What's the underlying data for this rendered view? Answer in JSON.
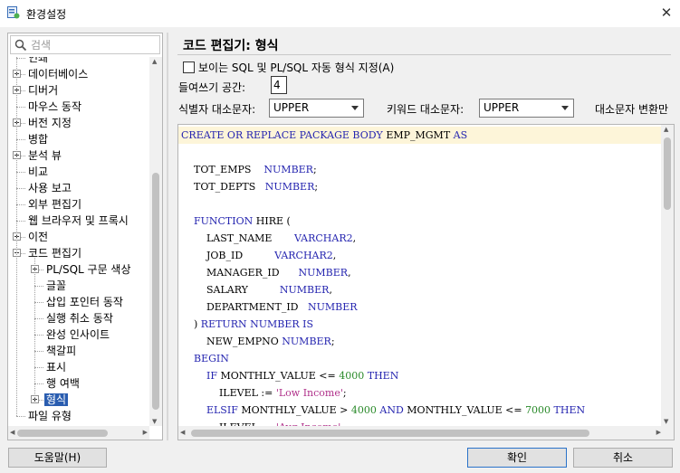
{
  "window": {
    "title": "환경설정",
    "close_glyph": "✕",
    "app_icon": "preferences-icon"
  },
  "search": {
    "placeholder": "검색",
    "icon": "search-icon"
  },
  "tree": {
    "items": [
      {
        "label": "인쇄",
        "level": 0,
        "expander": "none",
        "partial": true
      },
      {
        "label": "데이터베이스",
        "level": 0,
        "expander": "plus"
      },
      {
        "label": "디버거",
        "level": 0,
        "expander": "plus"
      },
      {
        "label": "마우스 동작",
        "level": 0,
        "expander": "none"
      },
      {
        "label": "버전 지정",
        "level": 0,
        "expander": "plus"
      },
      {
        "label": "병합",
        "level": 0,
        "expander": "none"
      },
      {
        "label": "분석 뷰",
        "level": 0,
        "expander": "plus"
      },
      {
        "label": "비교",
        "level": 0,
        "expander": "none"
      },
      {
        "label": "사용 보고",
        "level": 0,
        "expander": "none"
      },
      {
        "label": "외부 편집기",
        "level": 0,
        "expander": "none"
      },
      {
        "label": "웹 브라우저 및 프록시",
        "level": 0,
        "expander": "none"
      },
      {
        "label": "이전",
        "level": 0,
        "expander": "plus"
      },
      {
        "label": "코드 편집기",
        "level": 0,
        "expander": "minus"
      },
      {
        "label": "PL/SQL 구문 색상",
        "level": 1,
        "expander": "plus"
      },
      {
        "label": "글꼴",
        "level": 1,
        "expander": "none"
      },
      {
        "label": "삽입 포인터 동작",
        "level": 1,
        "expander": "none"
      },
      {
        "label": "실행 취소 동작",
        "level": 1,
        "expander": "none"
      },
      {
        "label": "완성 인사이트",
        "level": 1,
        "expander": "none"
      },
      {
        "label": "책갈피",
        "level": 1,
        "expander": "none"
      },
      {
        "label": "표시",
        "level": 1,
        "expander": "none"
      },
      {
        "label": "행 여백",
        "level": 1,
        "expander": "none"
      },
      {
        "label": "형식",
        "level": 1,
        "expander": "plus",
        "selected": true
      },
      {
        "label": "파일 유형",
        "level": 0,
        "expander": "none"
      }
    ]
  },
  "panel": {
    "title": "코드 편집기: 형식",
    "auto_format_label": "보이는 SQL 및 PL/SQL 자동 형식 지정(A)",
    "auto_format_checked": false,
    "indent_label": "들여쓰기 공간:",
    "indent_value": "4",
    "identifier_case_label": "식별자 대소문자:",
    "identifier_case_value": "UPPER",
    "keyword_case_label": "키워드 대소문자:",
    "keyword_case_value": "UPPER",
    "case_convert_label": "대소문자 변환만"
  },
  "code": {
    "lines": [
      [
        {
          "t": "CREATE OR REPLACE PACKAGE BODY ",
          "c": "kw"
        },
        {
          "t": "EMP_MGMT ",
          "c": ""
        },
        {
          "t": "AS",
          "c": "kw"
        }
      ],
      [],
      [
        {
          "t": "    TOT_EMPS    ",
          "c": ""
        },
        {
          "t": "NUMBER",
          "c": "kw"
        },
        {
          "t": ";",
          "c": ""
        }
      ],
      [
        {
          "t": "    TOT_DEPTS   ",
          "c": ""
        },
        {
          "t": "NUMBER",
          "c": "kw"
        },
        {
          "t": ";",
          "c": ""
        }
      ],
      [],
      [
        {
          "t": "    FUNCTION ",
          "c": "kw"
        },
        {
          "t": "HIRE (",
          "c": ""
        }
      ],
      [
        {
          "t": "        LAST_NAME       ",
          "c": ""
        },
        {
          "t": "VARCHAR2",
          "c": "kw"
        },
        {
          "t": ",",
          "c": ""
        }
      ],
      [
        {
          "t": "        JOB_ID          ",
          "c": ""
        },
        {
          "t": "VARCHAR2",
          "c": "kw"
        },
        {
          "t": ",",
          "c": ""
        }
      ],
      [
        {
          "t": "        MANAGER_ID      ",
          "c": ""
        },
        {
          "t": "NUMBER",
          "c": "kw"
        },
        {
          "t": ",",
          "c": ""
        }
      ],
      [
        {
          "t": "        SALARY          ",
          "c": ""
        },
        {
          "t": "NUMBER",
          "c": "kw"
        },
        {
          "t": ",",
          "c": ""
        }
      ],
      [
        {
          "t": "        DEPARTMENT_ID   ",
          "c": ""
        },
        {
          "t": "NUMBER",
          "c": "kw"
        }
      ],
      [
        {
          "t": "    ) ",
          "c": ""
        },
        {
          "t": "RETURN NUMBER IS",
          "c": "kw"
        }
      ],
      [
        {
          "t": "        NEW_EMPNO ",
          "c": ""
        },
        {
          "t": "NUMBER",
          "c": "kw"
        },
        {
          "t": ";",
          "c": ""
        }
      ],
      [
        {
          "t": "    BEGIN",
          "c": "kw"
        }
      ],
      [
        {
          "t": "        IF ",
          "c": "kw"
        },
        {
          "t": "MONTHLY_VALUE <= ",
          "c": ""
        },
        {
          "t": "4000",
          "c": "num"
        },
        {
          "t": " THEN",
          "c": "kw"
        }
      ],
      [
        {
          "t": "            ILEVEL := ",
          "c": ""
        },
        {
          "t": "'Low Income'",
          "c": "str"
        },
        {
          "t": ";",
          "c": ""
        }
      ],
      [
        {
          "t": "        ELSIF ",
          "c": "kw"
        },
        {
          "t": "MONTHLY_VALUE > ",
          "c": ""
        },
        {
          "t": "4000",
          "c": "num"
        },
        {
          "t": " AND ",
          "c": "kw"
        },
        {
          "t": "MONTHLY_VALUE <= ",
          "c": ""
        },
        {
          "t": "7000",
          "c": "num"
        },
        {
          "t": " THEN",
          "c": "kw"
        }
      ],
      [
        {
          "t": "            ILEVEL := ",
          "c": ""
        },
        {
          "t": "'Avg Income'",
          "c": "str"
        },
        {
          "t": ";",
          "c": ""
        }
      ]
    ]
  },
  "buttons": {
    "help": "도움말(H)",
    "ok": "확인",
    "cancel": "취소"
  }
}
